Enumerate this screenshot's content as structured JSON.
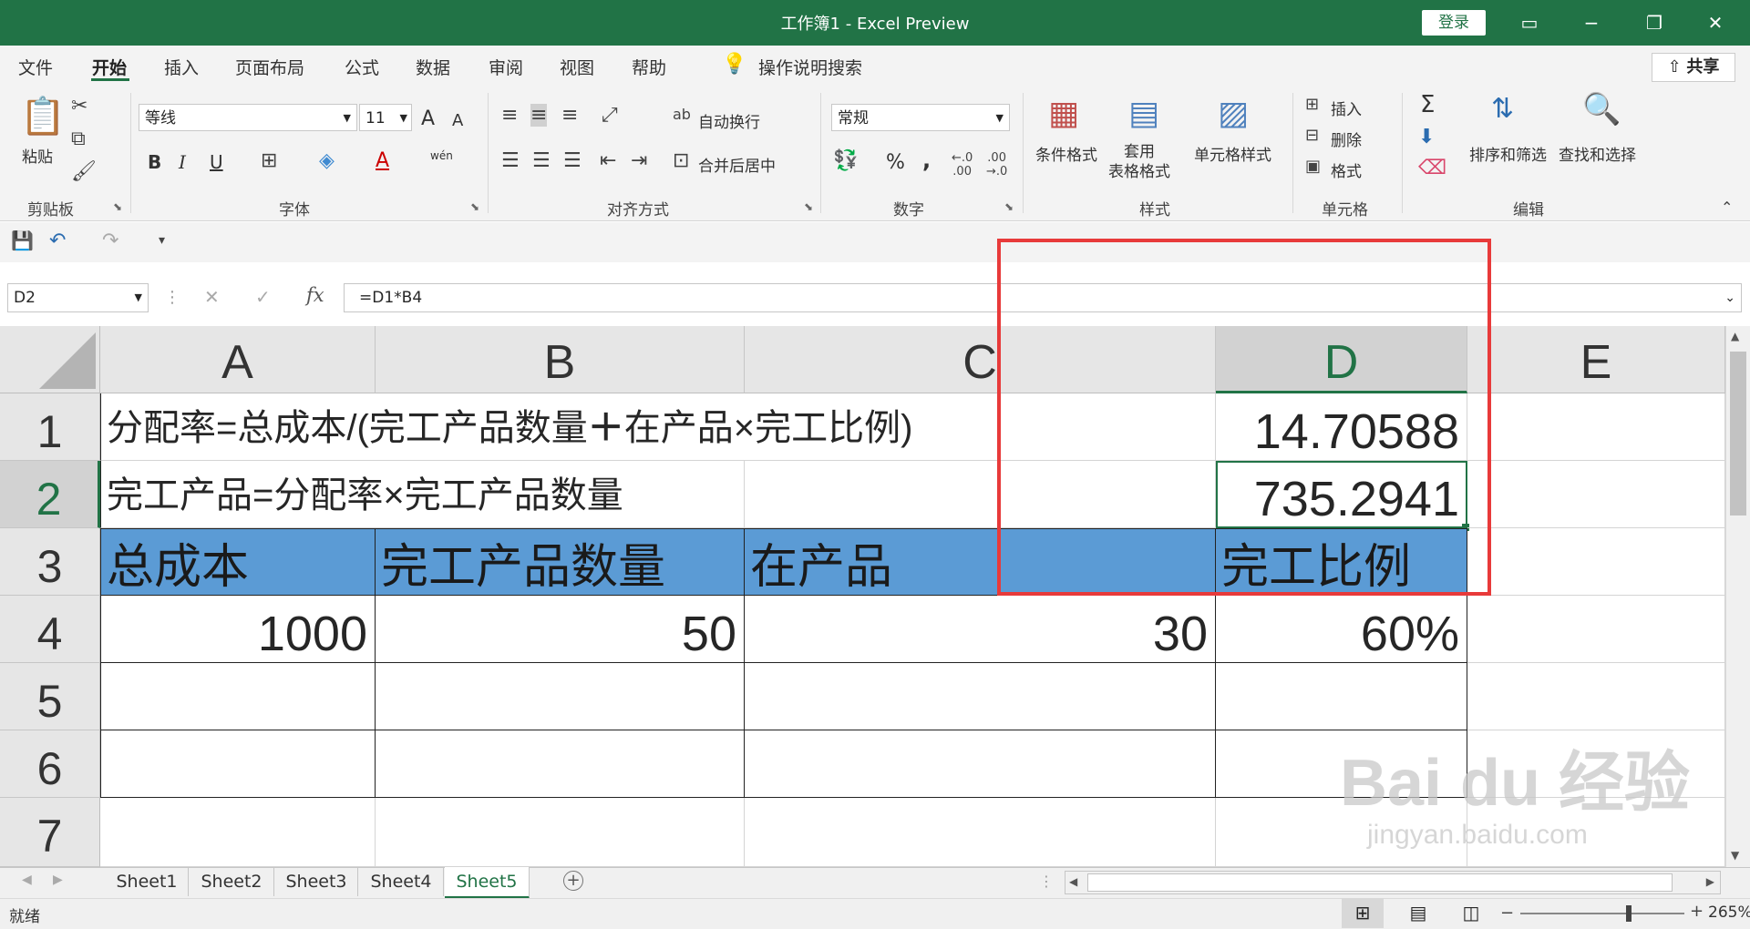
{
  "window": {
    "title": "工作簿1  -  Excel Preview",
    "login_label": "登录",
    "controls": [
      "▭",
      "−",
      "❐",
      "✕"
    ]
  },
  "ribbon_tabs": [
    "文件",
    "开始",
    "插入",
    "页面布局",
    "公式",
    "数据",
    "审阅",
    "视图",
    "帮助"
  ],
  "tell_me": "操作说明搜索",
  "share_label": "共享",
  "ribbon": {
    "clipboard": {
      "paste": "粘贴",
      "label": "剪贴板"
    },
    "font": {
      "name": "等线",
      "size": "11",
      "grow": "A",
      "shrink": "A",
      "bold": "B",
      "italic": "I",
      "underline": "U",
      "font_color": "A",
      "phonetic": "wén",
      "label": "字体"
    },
    "alignment": {
      "wrap": "自动换行",
      "merge": "合并后居中",
      "label": "对齐方式"
    },
    "number": {
      "format": "常规",
      "percent": "%",
      "comma": ",",
      "label": "数字"
    },
    "styles": {
      "conditional": "条件格式",
      "table": "套用\n表格格式",
      "cell_styles": "单元格样式",
      "label": "样式"
    },
    "cells": {
      "insert": "插入",
      "delete": "删除",
      "format": "格式",
      "label": "单元格"
    },
    "editing": {
      "sigma": "Σ",
      "sort": "排序和筛选",
      "find": "查找和选择",
      "label": "编辑"
    }
  },
  "formula_bar": {
    "name_box": "D2",
    "cancel": "✕",
    "enter": "✓",
    "fx": "fx",
    "formula": "=D1*B4"
  },
  "columns": [
    "A",
    "B",
    "C",
    "D",
    "E"
  ],
  "rows": [
    "1",
    "2",
    "3",
    "4",
    "5",
    "6",
    "7"
  ],
  "cells": {
    "A1": "分配率=总成本/(完工产品数量",
    "A1_plus": "＋",
    "A1_rest": "在产品×完工比例)",
    "D1": "14.70588",
    "A2": "完工产品=分配率×完工产品数量",
    "D2": "735.2941",
    "A3": "总成本",
    "B3": "完工产品数量",
    "C3": "在产品",
    "D3": "完工比例",
    "A4": "1000",
    "B4": "50",
    "C4": "30",
    "D4": "60%"
  },
  "sheet_tabs": [
    "Sheet1",
    "Sheet2",
    "Sheet3",
    "Sheet4",
    "Sheet5"
  ],
  "active_sheet": "Sheet5",
  "status": {
    "ready": "就绪",
    "zoom": "265%"
  },
  "watermark": {
    "brand": "Bai du 经验",
    "url": "jingyan.baidu.com"
  },
  "colors": {
    "excel_green": "#217346",
    "header_blue": "#5b9bd5",
    "highlight_red": "#e83a3a"
  }
}
